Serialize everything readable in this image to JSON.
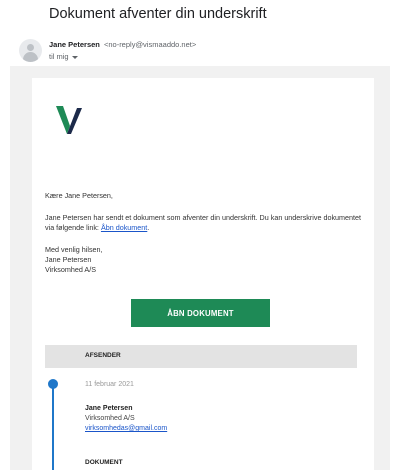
{
  "email": {
    "subject": "Dokument afventer din underskrift",
    "sender_name": "Jane Petersen",
    "sender_email": "<no-reply@vismaaddo.net>",
    "recipient": "til mig"
  },
  "message": {
    "greeting": "Kære Jane Petersen,",
    "body_text": "Jane Petersen har sendt et dokument som afventer din underskrift. Du kan underskrive dokumentet via følgende link: ",
    "body_link": "Åbn dokument",
    "body_end": ".",
    "closing": "Med venlig hilsen,",
    "closing_name": "Jane Petersen",
    "closing_company": "Virksomhed A/S"
  },
  "button": {
    "label": "ÅBN DOKUMENT"
  },
  "sender_section": {
    "label": "AFSENDER",
    "date": "11 februar 2021",
    "name": "Jane Petersen",
    "company": "Virksomhed A/S",
    "email": "virksomhedas@gmail.com"
  },
  "document_section": {
    "label": "DOKUMENT"
  },
  "colors": {
    "accent_green": "#1e8a56",
    "timeline_blue": "#1f77c9",
    "link_blue": "#1a55c9",
    "logo_green": "#1e8a56",
    "logo_navy": "#1c2a4a"
  },
  "icons": {
    "avatar": "default-avatar-icon",
    "dropdown": "chevron-down-icon",
    "logo": "visma-addo-logo"
  }
}
